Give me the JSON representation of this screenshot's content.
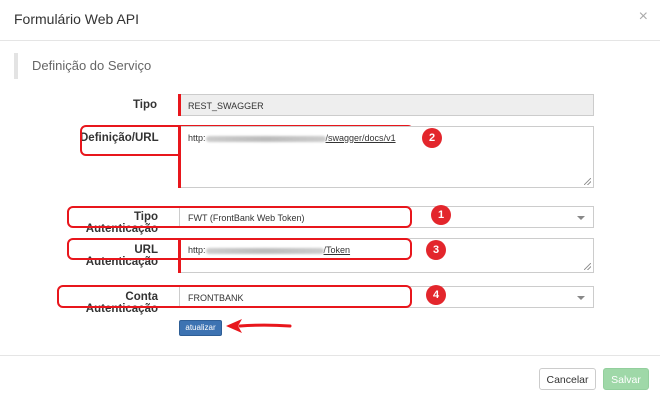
{
  "modal": {
    "title": "Formulário Web API",
    "close_glyph": "×"
  },
  "section": {
    "title": "Definição do Serviço"
  },
  "form": {
    "tipo": {
      "label": "Tipo",
      "value": "REST_SWAGGER"
    },
    "definicao_url": {
      "label": "Definição/URL",
      "value_prefix": "http:",
      "value_suffix_1": "/swagger",
      "value_suffix_2": "/docs",
      "value_suffix_3": "/v1"
    },
    "tipo_autenticacao": {
      "label": "Tipo Autenticação",
      "value": "FWT (FrontBank Web Token)"
    },
    "url_autenticacao": {
      "label": "URL Autenticação",
      "value_prefix": "http:",
      "value_suffix": "/Token"
    },
    "conta_autenticacao": {
      "label": "Conta Autenticação",
      "value": "FRONTBANK"
    }
  },
  "badges": [
    "1",
    "2",
    "3",
    "4"
  ],
  "buttons": {
    "atualizar": "atualizar",
    "cancelar": "Cancelar",
    "salvar": "Salvar"
  },
  "colors": {
    "annotation_red": "#e8161c",
    "primary": "#3d73b2",
    "success_disabled": "#9fd8a8"
  }
}
